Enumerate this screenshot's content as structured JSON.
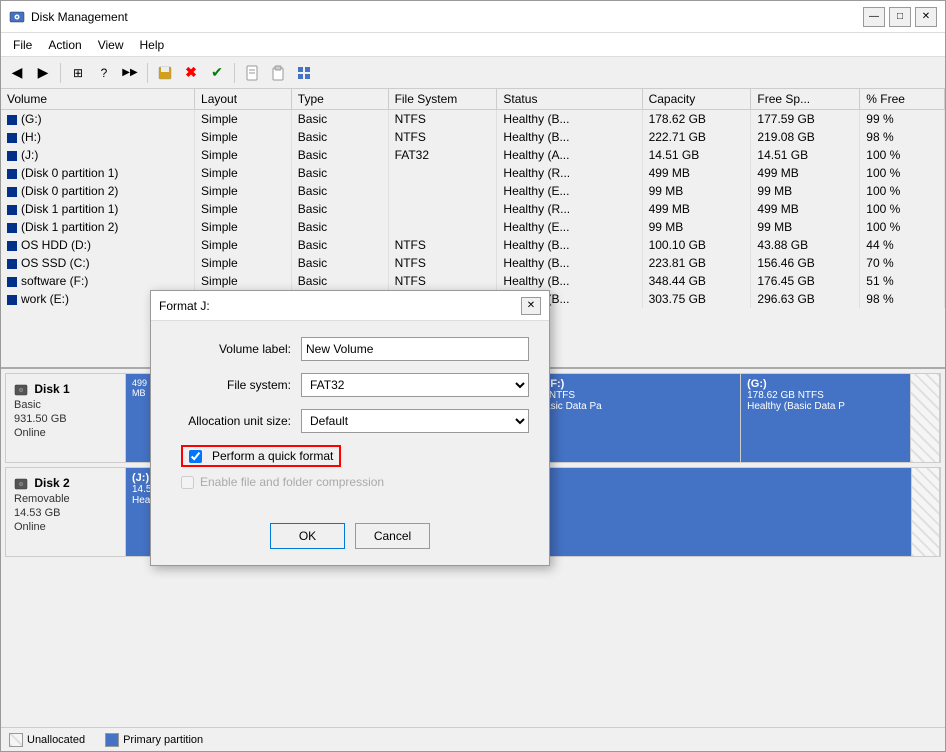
{
  "window": {
    "title": "Disk Management",
    "icon": "disk-icon"
  },
  "menu": {
    "items": [
      "File",
      "Action",
      "View",
      "Help"
    ]
  },
  "toolbar": {
    "buttons": [
      "◀",
      "▶",
      "⊞",
      "?",
      "▶▶",
      "🖫",
      "✖",
      "✔",
      "🖹",
      "📋",
      "▦"
    ]
  },
  "table": {
    "headers": [
      "Volume",
      "Layout",
      "Type",
      "File System",
      "Status",
      "Capacity",
      "Free Sp...",
      "% Free"
    ],
    "rows": [
      {
        "volume": "(G:)",
        "layout": "Simple",
        "type": "Basic",
        "fs": "NTFS",
        "status": "Healthy (B...",
        "capacity": "178.62 GB",
        "free": "177.59 GB",
        "pct": "99 %"
      },
      {
        "volume": "(H:)",
        "layout": "Simple",
        "type": "Basic",
        "fs": "NTFS",
        "status": "Healthy (B...",
        "capacity": "222.71 GB",
        "free": "219.08 GB",
        "pct": "98 %"
      },
      {
        "volume": "(J:)",
        "layout": "Simple",
        "type": "Basic",
        "fs": "FAT32",
        "status": "Healthy (A...",
        "capacity": "14.51 GB",
        "free": "14.51 GB",
        "pct": "100 %"
      },
      {
        "volume": "(Disk 0 partition 1)",
        "layout": "Simple",
        "type": "Basic",
        "fs": "",
        "status": "Healthy (R...",
        "capacity": "499 MB",
        "free": "499 MB",
        "pct": "100 %"
      },
      {
        "volume": "(Disk 0 partition 2)",
        "layout": "Simple",
        "type": "Basic",
        "fs": "",
        "status": "Healthy (E...",
        "capacity": "99 MB",
        "free": "99 MB",
        "pct": "100 %"
      },
      {
        "volume": "(Disk 1 partition 1)",
        "layout": "Simple",
        "type": "Basic",
        "fs": "",
        "status": "Healthy (R...",
        "capacity": "499 MB",
        "free": "499 MB",
        "pct": "100 %"
      },
      {
        "volume": "(Disk 1 partition 2)",
        "layout": "Simple",
        "type": "Basic",
        "fs": "",
        "status": "Healthy (E...",
        "capacity": "99 MB",
        "free": "99 MB",
        "pct": "100 %"
      },
      {
        "volume": "OS HDD (D:)",
        "layout": "Simple",
        "type": "Basic",
        "fs": "NTFS",
        "status": "Healthy (B...",
        "capacity": "100.10 GB",
        "free": "43.88 GB",
        "pct": "44 %"
      },
      {
        "volume": "OS SSD (C:)",
        "layout": "Simple",
        "type": "Basic",
        "fs": "NTFS",
        "status": "Healthy (B...",
        "capacity": "223.81 GB",
        "free": "156.46 GB",
        "pct": "70 %"
      },
      {
        "volume": "software (F:)",
        "layout": "Simple",
        "type": "Basic",
        "fs": "NTFS",
        "status": "Healthy (B...",
        "capacity": "348.44 GB",
        "free": "176.45 GB",
        "pct": "51 %"
      },
      {
        "volume": "work (E:)",
        "layout": "Simple",
        "type": "Basic",
        "fs": "",
        "status": "Healthy (B...",
        "capacity": "303.75 GB",
        "free": "296.63 GB",
        "pct": "98 %"
      }
    ]
  },
  "disk_visual": {
    "disks": [
      {
        "name": "Disk 1",
        "type": "Basic",
        "size": "931.50 GB",
        "status": "Online",
        "partitions": [
          {
            "name": "software (F:)",
            "detail1": "348.44 GB NTFS",
            "detail2": "Healthy (Basic Data Pa",
            "type": "primary",
            "flex": 3
          },
          {
            "name": "(G:)",
            "detail1": "178.62 GB NTFS",
            "detail2": "Healthy (Basic Data P",
            "type": "primary",
            "flex": 2
          },
          {
            "name": "unalloc1",
            "detail1": "",
            "detail2": "",
            "type": "unalloc",
            "flex": 0.2
          }
        ]
      },
      {
        "name": "Disk 2",
        "type": "Removable",
        "size": "14.53 GB",
        "status": "Online",
        "partitions": [
          {
            "name": "(J:)",
            "detail1": "14.51 GB FAT32",
            "detail2": "Healthy (Active, Primary Partition)",
            "type": "primary",
            "flex": 5
          },
          {
            "name": "unalloc2",
            "detail1": "",
            "detail2": "",
            "type": "unalloc",
            "flex": 0.1
          }
        ]
      }
    ]
  },
  "status_bar": {
    "unallocated_label": "Unallocated",
    "primary_partition_label": "Primary partition"
  },
  "modal": {
    "title": "Format J:",
    "volume_label_label": "Volume label:",
    "volume_label_value": "New Volume",
    "file_system_label": "File system:",
    "file_system_value": "FAT32",
    "allocation_label": "Allocation unit size:",
    "allocation_value": "Default",
    "quick_format_label": "Perform a quick format",
    "compression_label": "Enable file and folder compression",
    "ok_label": "OK",
    "cancel_label": "Cancel"
  }
}
